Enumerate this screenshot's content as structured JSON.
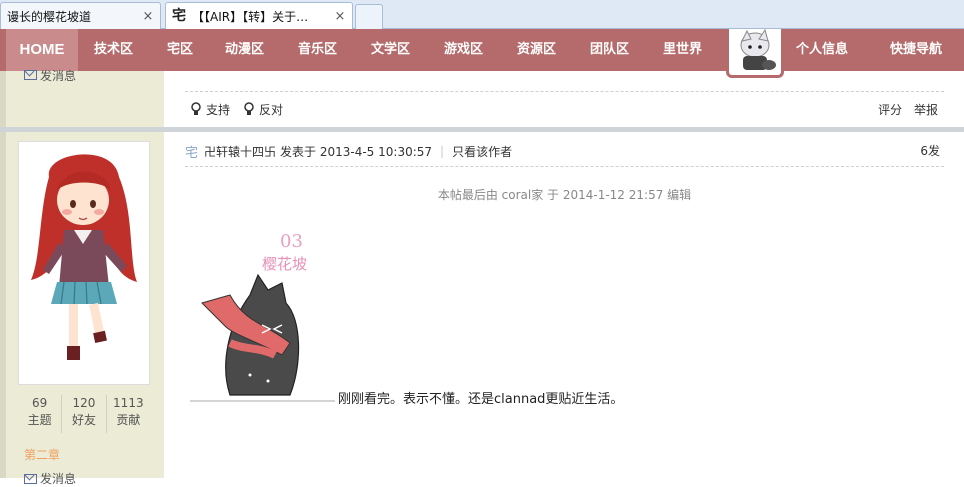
{
  "browser": {
    "tabs": [
      {
        "title": "谩长的樱花坡道",
        "close": "×"
      },
      {
        "title": "【【AIR】【转】关于…",
        "favicon": "宅",
        "close": "×"
      }
    ]
  },
  "nav": {
    "home": "HOME",
    "items": [
      "技术区",
      "宅区",
      "动漫区",
      "音乐区",
      "文学区",
      "游戏区",
      "资源区",
      "团队区",
      "里世界",
      "个人信息",
      "快捷导航"
    ]
  },
  "sidebar": {
    "send_message": "发消息",
    "stats": [
      {
        "value": "69",
        "label": "主题"
      },
      {
        "value": "120",
        "label": "好友"
      },
      {
        "value": "1113",
        "label": "贡献"
      }
    ],
    "rank": "第二章",
    "send_message_2": "发消息"
  },
  "post_actions": {
    "support": "支持",
    "oppose": "反对",
    "rate": "评分",
    "report": "举报"
  },
  "post": {
    "badge": "宅",
    "author": "卍轩辕十四卐",
    "posted_at": "发表于 2013-4-5 10:30:57",
    "only_author": "只看该作者",
    "floor": "6发",
    "edited_note": "本帖最后由 coral家 于 2014-1-12 21:57 编辑",
    "sticker_text_1": "03",
    "sticker_text_2": "樱花坡",
    "body": "刚刚看完。表示不懂。还是clannad更贴近生活。"
  },
  "colors": {
    "nav_bg": "#b56b6b",
    "sidebar_bg": "#ebebd6",
    "rank_color": "#f0a060"
  }
}
